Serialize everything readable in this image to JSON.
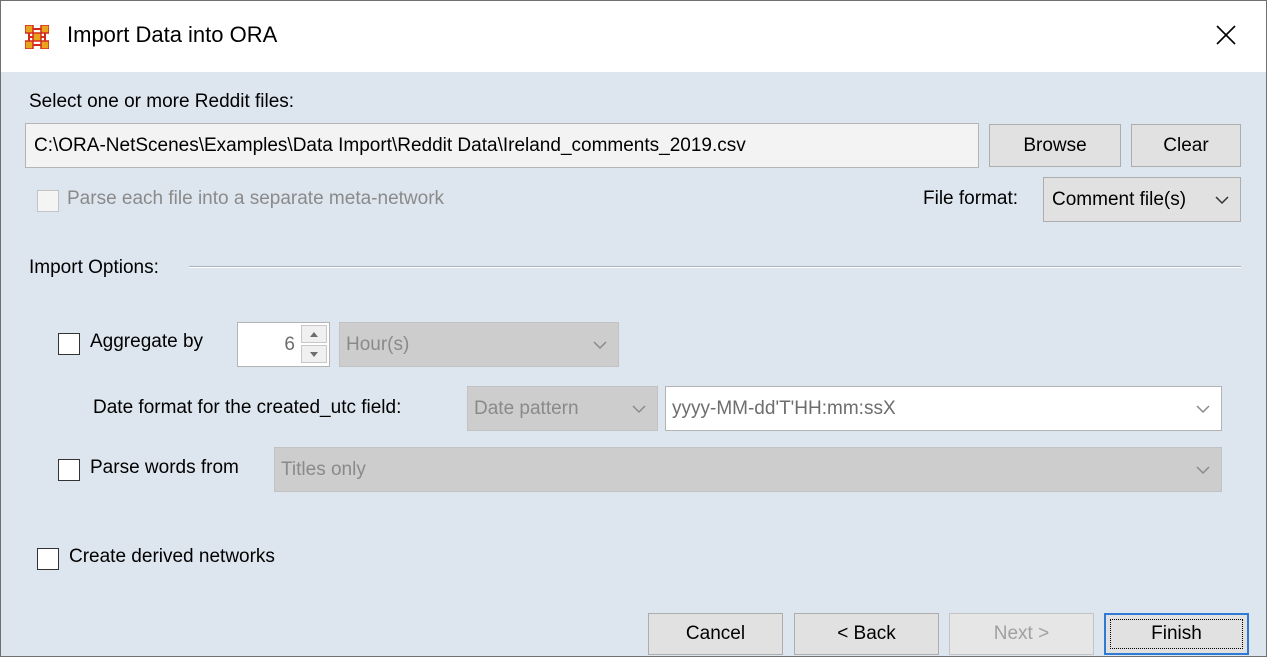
{
  "window": {
    "title": "Import Data into ORA",
    "app_icon": "ora-network-icon",
    "close_icon": "close-icon"
  },
  "files": {
    "label": "Select one or more Reddit files:",
    "path_value": "C:\\ORA-NetScenes\\Examples\\Data Import\\Reddit Data\\Ireland_comments_2019.csv",
    "browse_label": "Browse",
    "clear_label": "Clear"
  },
  "parse_separate": {
    "label": "Parse each file into a separate meta-network",
    "checked": false,
    "enabled": false
  },
  "file_format": {
    "label": "File format:",
    "value": "Comment file(s)"
  },
  "import_options": {
    "label": "Import Options:",
    "aggregate": {
      "label": "Aggregate by",
      "checked": false,
      "amount": "6",
      "unit": "Hour(s)"
    },
    "date_format": {
      "label": "Date format for the created_utc field:",
      "type": "Date pattern",
      "pattern": "yyyy-MM-dd'T'HH:mm:ssX"
    },
    "parse_words": {
      "label": "Parse words from",
      "checked": false,
      "value": "Titles only"
    }
  },
  "derived": {
    "label": "Create derived networks",
    "checked": false
  },
  "footer": {
    "cancel_label": "Cancel",
    "back_label": "< Back",
    "next_label": "Next >",
    "finish_label": "Finish"
  },
  "colors": {
    "dialog_bg": "#dde6ef",
    "default_button_border": "#2f7ad2",
    "icon_orange": "#e8a51c",
    "icon_red": "#d42a1e"
  }
}
